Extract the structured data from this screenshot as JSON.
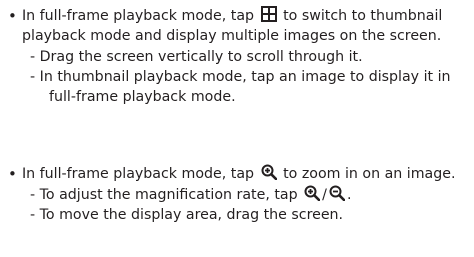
{
  "section1": {
    "bullet_before_icon": "In full-frame playback mode, tap",
    "bullet_after_icon": "to switch to thumbnail",
    "bullet_line2": "playback mode and display multiple images on the screen.",
    "sub1": "-  Drag the screen vertically to scroll through it.",
    "sub2_line1": "-  In thumbnail playback mode, tap an image to display it in",
    "sub2_line2": "full-frame playback mode.",
    "icon": "thumbnail-grid-icon"
  },
  "section2": {
    "bullet_before_icon": "In full-frame playback mode, tap",
    "bullet_after_icon": "to zoom in on an image.",
    "sub1_before": "-  To adjust the magnification rate, tap",
    "sub1_sep": "/",
    "sub1_after": ".",
    "sub2": "-  To move the display area, drag the screen.",
    "icons": [
      "zoom-in-icon",
      "zoom-out-icon"
    ]
  },
  "bullet_glyph": "•",
  "colors": {
    "text": "#231f20",
    "icon": "#231f20"
  }
}
